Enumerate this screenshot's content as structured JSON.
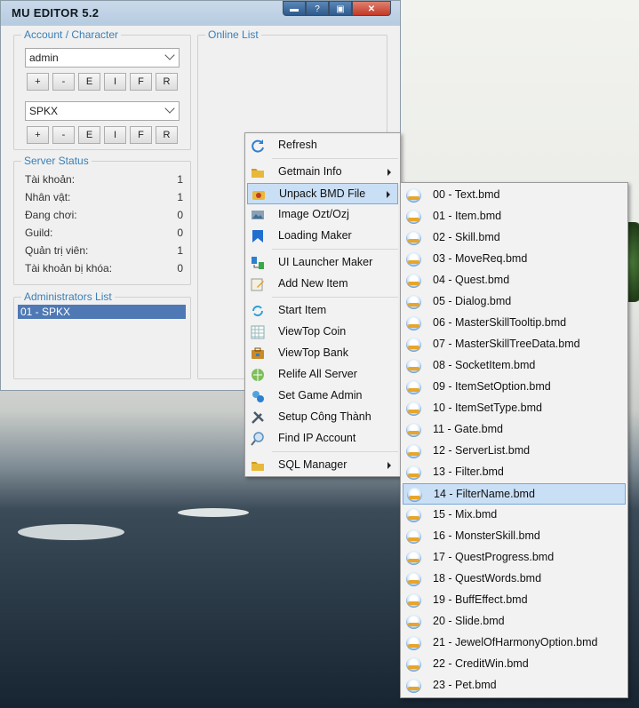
{
  "window": {
    "title": "MU EDITOR 5.2",
    "buttons": {
      "minimize": "▬",
      "help": "?",
      "maximize": "▣",
      "close": "✕"
    }
  },
  "account_group": {
    "legend": "Account / Character",
    "account_value": "admin",
    "character_value": "SPKX",
    "buttons": [
      "+",
      "-",
      "E",
      "I",
      "F",
      "R"
    ]
  },
  "online_list": {
    "legend": "Online List"
  },
  "server_status": {
    "legend": "Server Status",
    "rows": [
      {
        "label": "Tài khoản:",
        "value": "1"
      },
      {
        "label": "Nhân vật:",
        "value": "1"
      },
      {
        "label": "Đang chơi:",
        "value": "0"
      },
      {
        "label": "Guild:",
        "value": "0"
      },
      {
        "label": "Quản trị viên:",
        "value": "1"
      },
      {
        "label": "Tài khoản bị khóa:",
        "value": "0"
      }
    ]
  },
  "administrators": {
    "legend": "Administrators List",
    "items": [
      "01 - SPKX"
    ]
  },
  "context_menu": {
    "items": [
      {
        "label": "Refresh",
        "icon": "refresh-icon"
      },
      {
        "label": "Getmain Info",
        "icon": "folder-icon",
        "submenu": true
      },
      {
        "label": "Unpack BMD File",
        "icon": "unpack-icon",
        "submenu": true,
        "highlighted": true
      },
      {
        "label": "Image Ozt/Ozj",
        "icon": "image-icon"
      },
      {
        "label": "Loading Maker",
        "icon": "bookmark-icon"
      },
      {
        "label": "UI Launcher Maker",
        "icon": "launcher-icon"
      },
      {
        "label": "Add New Item",
        "icon": "edit-icon"
      },
      {
        "label": "Start Item",
        "icon": "cycle-icon"
      },
      {
        "label": "ViewTop Coin",
        "icon": "grid-icon"
      },
      {
        "label": "ViewTop Bank",
        "icon": "briefcase-icon"
      },
      {
        "label": "Relife All Server",
        "icon": "globe-icon"
      },
      {
        "label": "Set Game Admin",
        "icon": "admin-icon"
      },
      {
        "label": "Setup Công Thành",
        "icon": "tools-icon"
      },
      {
        "label": "Find IP Account",
        "icon": "magnifier-icon"
      },
      {
        "label": "SQL Manager",
        "icon": "folder-icon",
        "submenu": true
      }
    ]
  },
  "bmd_submenu": {
    "items": [
      "00 - Text.bmd",
      "01 - Item.bmd",
      "02 - Skill.bmd",
      "03 - MoveReq.bmd",
      "04 - Quest.bmd",
      "05 - Dialog.bmd",
      "06 - MasterSkillTooltip.bmd",
      "07 - MasterSkillTreeData.bmd",
      "08 - SocketItem.bmd",
      "09 - ItemSetOption.bmd",
      "10 - ItemSetType.bmd",
      "11 - Gate.bmd",
      "12 - ServerList.bmd",
      "13 - Filter.bmd",
      "14 - FilterName.bmd",
      "15 - Mix.bmd",
      "16 - MonsterSkill.bmd",
      "17 - QuestProgress.bmd",
      "18 - QuestWords.bmd",
      "19 - BuffEffect.bmd",
      "20 - Slide.bmd",
      "21 - JewelOfHarmonyOption.bmd",
      "22 - CreditWin.bmd",
      "23 - Pet.bmd"
    ],
    "highlighted_item": "14 - FilterName.bmd"
  }
}
